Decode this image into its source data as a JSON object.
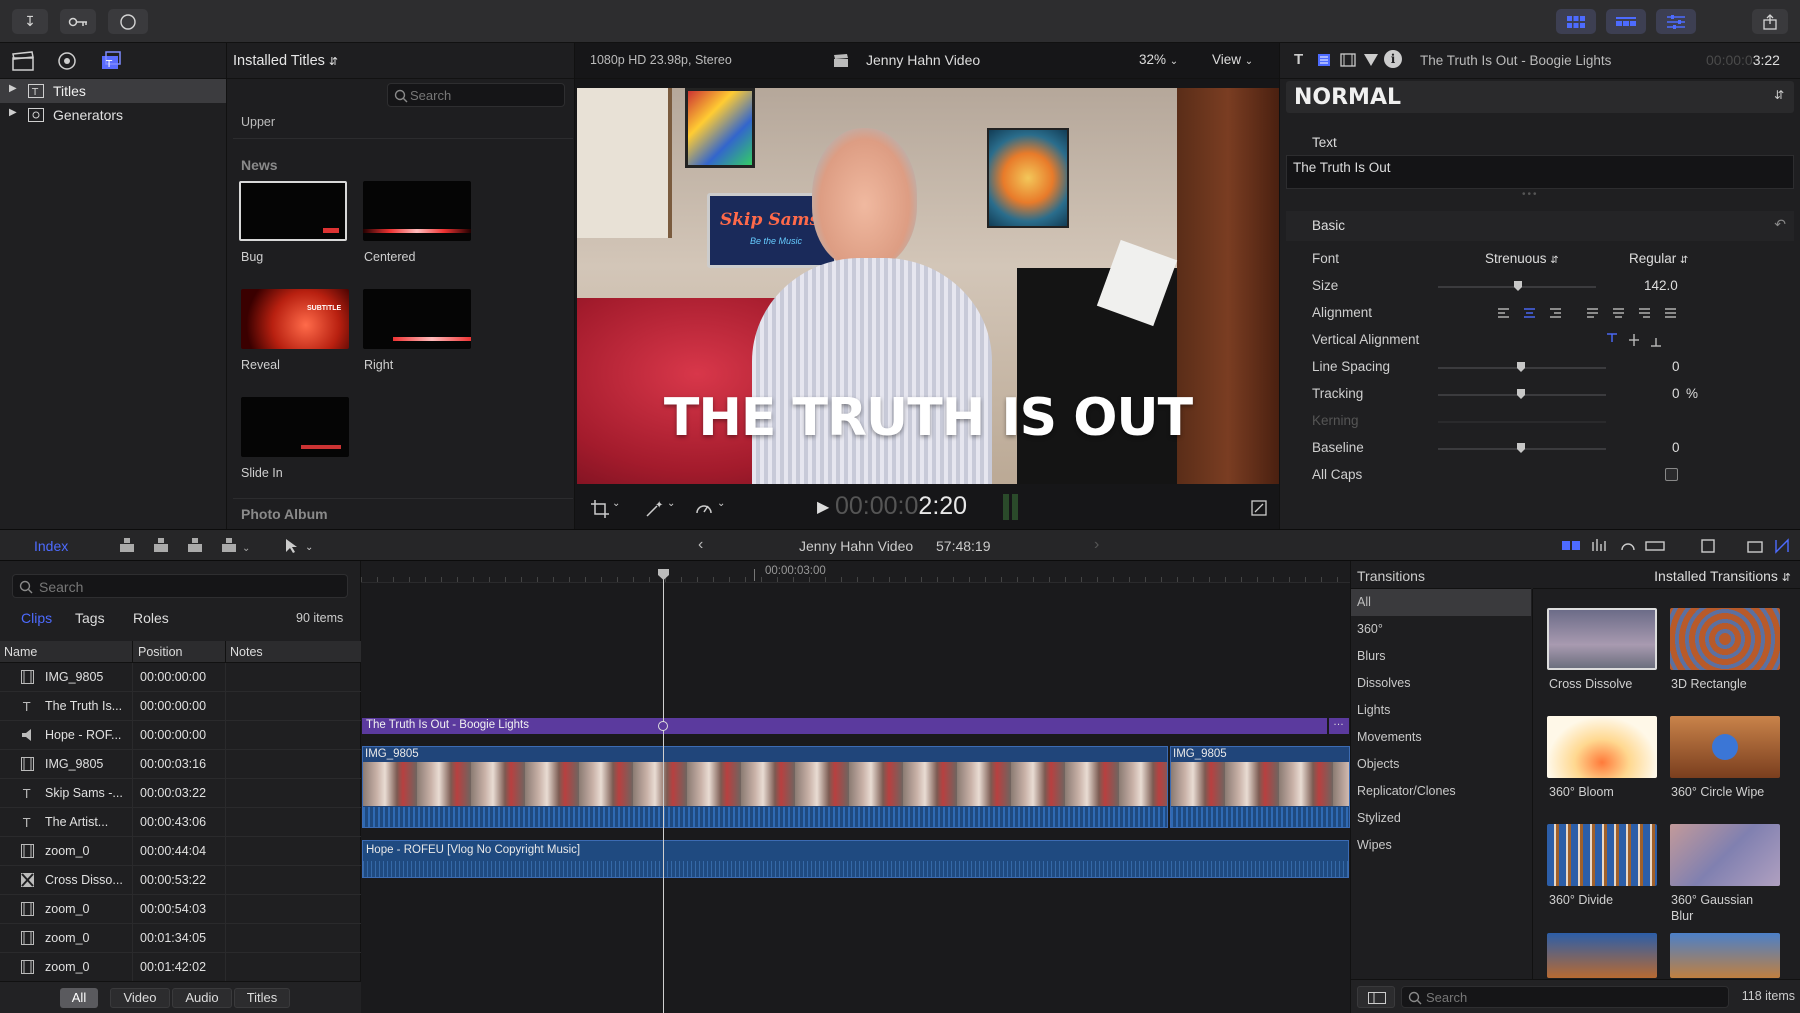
{
  "toolbar": {
    "import_icon": "download-arrow-icon",
    "keywords_icon": "key-icon",
    "background_tasks_icon": "circle-icon",
    "share_icon": "share-icon"
  },
  "library": {
    "items": [
      {
        "label": "Titles",
        "selected": true
      },
      {
        "label": "Generators",
        "selected": false
      }
    ]
  },
  "browser": {
    "title": "Installed Titles",
    "search_placeholder": "Search",
    "upper_label": "Upper",
    "section_news": "News",
    "section_photo": "Photo Album",
    "titles": [
      {
        "label": "Bug"
      },
      {
        "label": "Centered"
      },
      {
        "label": "Reveal"
      },
      {
        "label": "Right"
      },
      {
        "label": "Slide In"
      }
    ],
    "reveal_text": "SUBTITLE"
  },
  "viewer": {
    "format": "1080p HD 23.98p, Stereo",
    "project": "Jenny Hahn Video",
    "zoom": "32%",
    "view": "View",
    "title_overlay": "THE TRUTH IS OUT",
    "timecode_dim": "00:00:0",
    "timecode_bright": "2:20",
    "monitor_text": "Skip Sams",
    "monitor_sub": "Be the Music"
  },
  "inspector": {
    "clip_title": "The Truth Is Out - Boogie Lights",
    "duration_dim": "00:00:0",
    "duration_bright": "3:22",
    "preset": "NORMAL",
    "text_label": "Text",
    "text_value": "The Truth Is Out",
    "basic_label": "Basic",
    "rows": {
      "font_label": "Font",
      "font_value": "Strenuous",
      "font_style": "Regular",
      "size_label": "Size",
      "size_value": "142.0",
      "alignment_label": "Alignment",
      "valign_label": "Vertical Alignment",
      "line_spacing_label": "Line Spacing",
      "line_spacing_value": "0",
      "tracking_label": "Tracking",
      "tracking_value": "0",
      "tracking_unit": "%",
      "kerning_label": "Kerning",
      "baseline_label": "Baseline",
      "baseline_value": "0",
      "allcaps_label": "All Caps"
    }
  },
  "timeline_bar": {
    "index_label": "Index",
    "project": "Jenny Hahn Video",
    "duration": "57:48:19"
  },
  "index": {
    "search_placeholder": "Search",
    "tabs": [
      "Clips",
      "Tags",
      "Roles"
    ],
    "count": "90 items",
    "columns": [
      "Name",
      "Position",
      "Notes"
    ],
    "rows": [
      {
        "icon": "film-icon",
        "name": "IMG_9805",
        "position": "00:00:00:00"
      },
      {
        "icon": "title-icon",
        "name": "The Truth Is...",
        "position": "00:00:00:00"
      },
      {
        "icon": "audio-icon",
        "name": "Hope - ROF...",
        "position": "00:00:00:00"
      },
      {
        "icon": "film-icon",
        "name": "IMG_9805",
        "position": "00:00:03:16"
      },
      {
        "icon": "title-icon",
        "name": "Skip Sams -...",
        "position": "00:00:03:22"
      },
      {
        "icon": "title-icon",
        "name": "The Artist...",
        "position": "00:00:43:06"
      },
      {
        "icon": "film-icon",
        "name": "zoom_0",
        "position": "00:00:44:04"
      },
      {
        "icon": "transition-icon",
        "name": "Cross Disso...",
        "position": "00:00:53:22"
      },
      {
        "icon": "film-icon",
        "name": "zoom_0",
        "position": "00:00:54:03"
      },
      {
        "icon": "film-icon",
        "name": "zoom_0",
        "position": "00:01:34:05"
      },
      {
        "icon": "film-icon",
        "name": "zoom_0",
        "position": "00:01:42:02"
      }
    ],
    "filters": [
      "All",
      "Video",
      "Audio",
      "Titles"
    ]
  },
  "timeline": {
    "ruler_time": "00:00:03:00",
    "title_clip": "The Truth Is Out - Boogie Lights",
    "video_clip_1": "IMG_9805",
    "video_clip_2": "IMG_9805",
    "audio_clip": "Hope - ROFEU [Vlog No Copyright Music]"
  },
  "transitions": {
    "title": "Transitions",
    "installed": "Installed Transitions",
    "categories": [
      "All",
      "360°",
      "Blurs",
      "Dissolves",
      "Lights",
      "Movements",
      "Objects",
      "Replicator/Clones",
      "Stylized",
      "Wipes"
    ],
    "items": [
      {
        "label": "Cross Dissolve"
      },
      {
        "label": "3D Rectangle"
      },
      {
        "label": "360° Bloom"
      },
      {
        "label": "360° Circle Wipe"
      },
      {
        "label": "360° Divide"
      },
      {
        "label": "360° Gaussian"
      },
      {
        "label": "Blur"
      }
    ],
    "search_placeholder": "Search",
    "count": "118 items"
  },
  "colors": {
    "accent_blue": "#4d6bff",
    "title_clip_purple": "#5b3a9e",
    "video_clip_blue": "#20457a",
    "audio_clip_blue": "#1f4a80"
  }
}
